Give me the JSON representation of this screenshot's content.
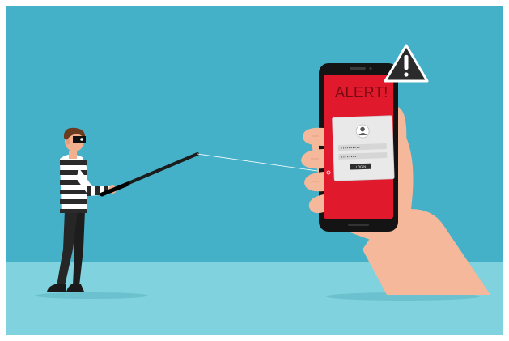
{
  "phone": {
    "alert_text": "ALERT!",
    "password_mask": "••••••••••",
    "password_mask_2": "••••••••",
    "login_button": "LOGIN"
  },
  "colors": {
    "sky": "#45b1c9",
    "floor": "#7fd2de",
    "phone_screen": "#e0192d",
    "phone_body": "#141414",
    "skin": "#f6b89a",
    "warning_badge": "#2b2b2b"
  },
  "icons": [
    "warning-icon",
    "user-icon"
  ]
}
